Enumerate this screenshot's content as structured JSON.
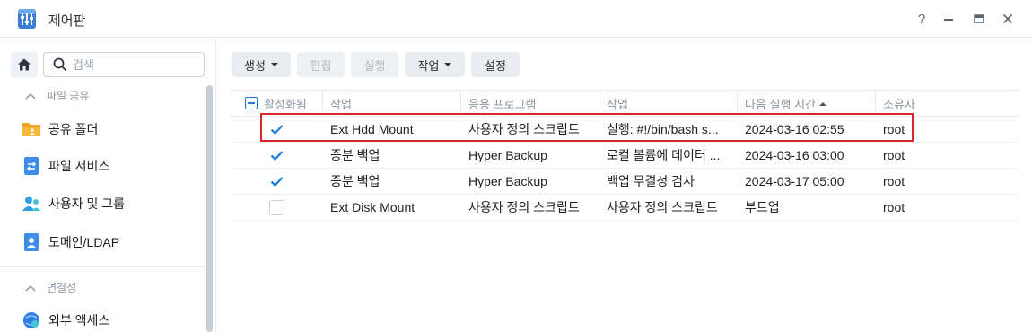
{
  "window": {
    "title": "제어판",
    "help_label": "?"
  },
  "search": {
    "placeholder": "검색",
    "value": ""
  },
  "sidebar": {
    "sections": [
      {
        "label": "파일 공유",
        "expanded": true
      },
      {
        "label": "연결성",
        "expanded": true
      }
    ],
    "items": [
      {
        "label": "공유 폴더",
        "icon": "shared-folder-icon"
      },
      {
        "label": "파일 서비스",
        "icon": "file-services-icon"
      },
      {
        "label": "사용자 및 그룹",
        "icon": "users-groups-icon"
      },
      {
        "label": "도메인/LDAP",
        "icon": "domain-ldap-icon"
      },
      {
        "label": "외부 액세스",
        "icon": "external-access-icon"
      }
    ]
  },
  "toolbar": {
    "create": "생성",
    "edit": "편집",
    "run": "실행",
    "action": "작업",
    "settings": "설정"
  },
  "grid": {
    "columns": [
      "활성화됨",
      "작업",
      "응용 프로그램",
      "작업",
      "다음 실행 시간",
      "소유자"
    ],
    "rows": [
      {
        "enabled": true,
        "task": "Ext Hdd Mount",
        "app": "사용자 정의 스크립트",
        "action": "실행: #!/bin/bash s...",
        "next_run": "2024-03-16 02:55",
        "owner": "root",
        "highlighted": true
      },
      {
        "enabled": true,
        "task": "증분 백업",
        "app": "Hyper Backup",
        "action": "로컬 볼륨에 데이터 ...",
        "next_run": "2024-03-16 03:00",
        "owner": "root",
        "highlighted": false
      },
      {
        "enabled": true,
        "task": "증분 백업",
        "app": "Hyper Backup",
        "action": "백업 무결성 검사",
        "next_run": "2024-03-17 05:00",
        "owner": "root",
        "highlighted": false
      },
      {
        "enabled": false,
        "task": "Ext Disk Mount",
        "app": "사용자 정의 스크립트",
        "action": "사용자 정의 스크립트",
        "next_run": "부트업",
        "owner": "root",
        "highlighted": false
      }
    ]
  },
  "colors": {
    "accent": "#1c7bd8",
    "highlight_border": "#d9262b",
    "toolbar_button": "#e9edf2"
  }
}
